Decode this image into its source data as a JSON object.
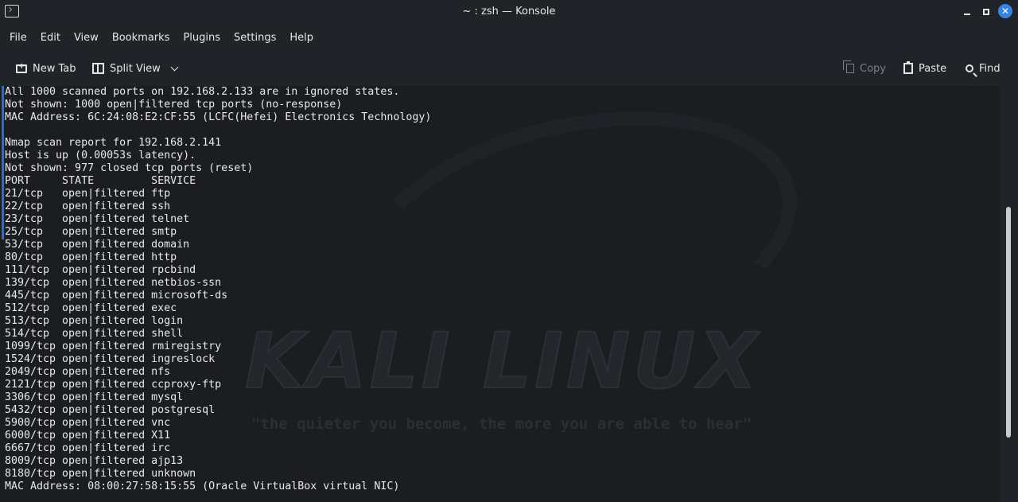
{
  "titlebar": {
    "title": "~ : zsh — Konsole"
  },
  "menu": {
    "items": [
      "File",
      "Edit",
      "View",
      "Bookmarks",
      "Plugins",
      "Settings",
      "Help"
    ]
  },
  "toolbar": {
    "new_tab": "New Tab",
    "split_view": "Split View",
    "copy": "Copy",
    "paste": "Paste",
    "find": "Find"
  },
  "background": {
    "logo_text": "KALI LINUX",
    "tagline": "\"the quieter you become, the more you are able to hear\""
  },
  "terminal": {
    "lines": [
      "All 1000 scanned ports on 192.168.2.133 are in ignored states.",
      "Not shown: 1000 open|filtered tcp ports (no-response)",
      "MAC Address: 6C:24:08:E2:CF:55 (LCFC(Hefei) Electronics Technology)",
      "",
      "Nmap scan report for 192.168.2.141",
      "Host is up (0.00053s latency).",
      "Not shown: 977 closed tcp ports (reset)",
      "PORT     STATE         SERVICE",
      "21/tcp   open|filtered ftp",
      "22/tcp   open|filtered ssh",
      "23/tcp   open|filtered telnet",
      "25/tcp   open|filtered smtp",
      "53/tcp   open|filtered domain",
      "80/tcp   open|filtered http",
      "111/tcp  open|filtered rpcbind",
      "139/tcp  open|filtered netbios-ssn",
      "445/tcp  open|filtered microsoft-ds",
      "512/tcp  open|filtered exec",
      "513/tcp  open|filtered login",
      "514/tcp  open|filtered shell",
      "1099/tcp open|filtered rmiregistry",
      "1524/tcp open|filtered ingreslock",
      "2049/tcp open|filtered nfs",
      "2121/tcp open|filtered ccproxy-ftp",
      "3306/tcp open|filtered mysql",
      "5432/tcp open|filtered postgresql",
      "5900/tcp open|filtered vnc",
      "6000/tcp open|filtered X11",
      "6667/tcp open|filtered irc",
      "8009/tcp open|filtered ajp13",
      "8180/tcp open|filtered unknown",
      "MAC Address: 08:00:27:58:15:55 (Oracle VirtualBox virtual NIC)"
    ]
  },
  "colors": {
    "accent": "#3584e4",
    "terminal_bg": "#1b1d21",
    "text": "#e8e9eb"
  }
}
